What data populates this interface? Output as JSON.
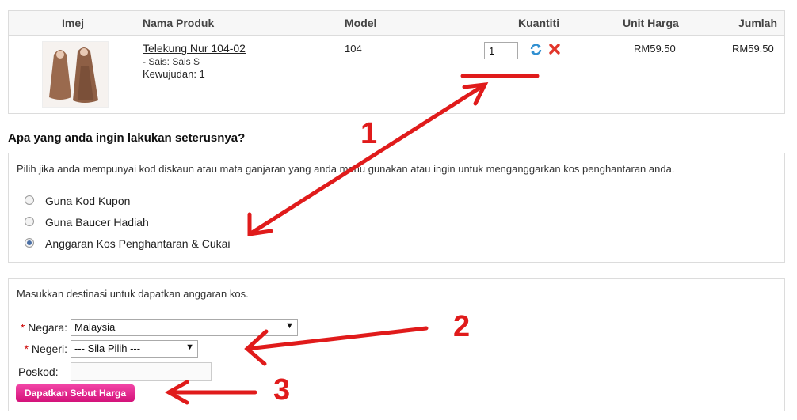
{
  "cart": {
    "headers": {
      "image": "Imej",
      "name": "Nama Produk",
      "model": "Model",
      "qty": "Kuantiti",
      "unit_price": "Unit Harga",
      "total": "Jumlah"
    },
    "item": {
      "name": "Telekung Nur 104-02",
      "option": "- Sais: Sais S",
      "stock": "Kewujudan: 1",
      "model": "104",
      "qty": "1",
      "unit_price": "RM59.50",
      "total": "RM59.50",
      "update_icon": "refresh-icon",
      "remove_icon": "remove-x-icon"
    }
  },
  "next_steps": {
    "title": "Apa yang anda ingin lakukan seterusnya?",
    "description": "Pilih jika anda mempunyai kod diskaun atau mata ganjaran yang anda mahu gunakan atau ingin untuk menganggarkan kos penghantaran anda.",
    "options": [
      {
        "label": "Guna Kod Kupon",
        "checked": false
      },
      {
        "label": "Guna Baucer Hadiah",
        "checked": false
      },
      {
        "label": "Anggaran Kos Penghantaran & Cukai",
        "checked": true
      }
    ]
  },
  "shipping": {
    "description": "Masukkan destinasi untuk dapatkan anggaran kos.",
    "country_label": "Negara:",
    "country_value": "Malaysia",
    "state_label": "Negeri:",
    "state_value": "--- Sila Pilih ---",
    "postcode_label": "Poskod:",
    "postcode_value": "",
    "required_mark": "*",
    "quote_button": "Dapatkan Sebut Harga"
  },
  "annotations": {
    "labels": [
      "1",
      "2",
      "3"
    ],
    "color": "#e01b1b"
  }
}
